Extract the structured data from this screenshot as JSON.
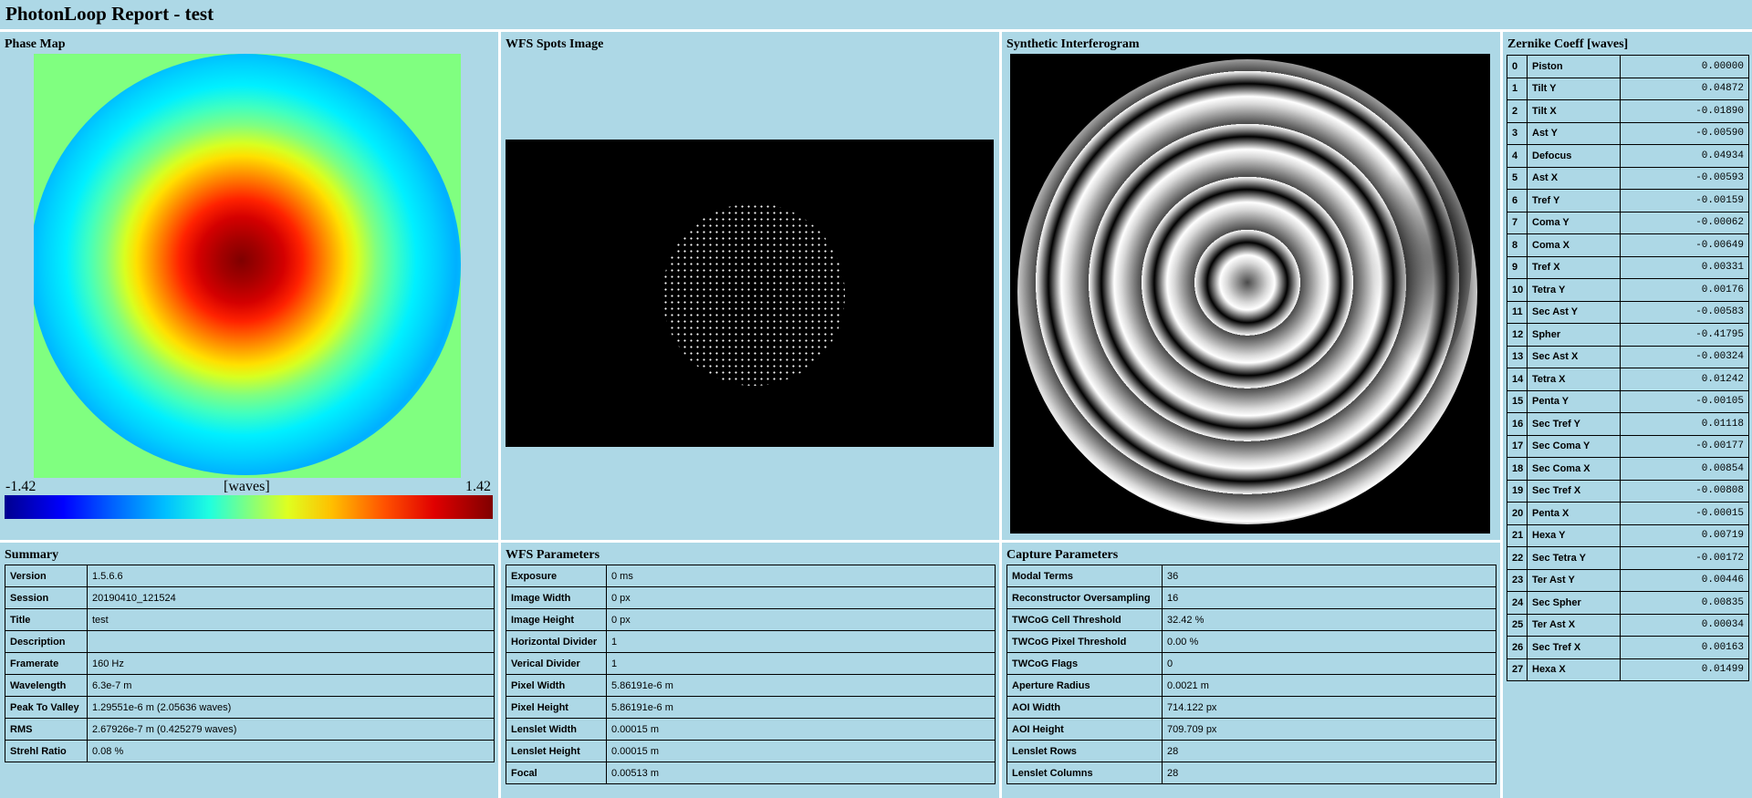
{
  "app": {
    "title": "PhotonLoop Report - test"
  },
  "phase_map": {
    "title": "Phase Map",
    "min_label": "-1.42",
    "max_label": "1.42",
    "unit_label": "[waves]"
  },
  "spots": {
    "title": "WFS Spots Image"
  },
  "interferogram": {
    "title": "Synthetic Interferogram"
  },
  "zernike": {
    "title": "Zernike Coeff [waves]",
    "rows": [
      {
        "index": "0",
        "name": "Piston",
        "value": "0.00000"
      },
      {
        "index": "1",
        "name": "Tilt Y",
        "value": "0.04872"
      },
      {
        "index": "2",
        "name": "Tilt X",
        "value": "-0.01890"
      },
      {
        "index": "3",
        "name": "Ast Y",
        "value": "-0.00590"
      },
      {
        "index": "4",
        "name": "Defocus",
        "value": "0.04934"
      },
      {
        "index": "5",
        "name": "Ast X",
        "value": "-0.00593"
      },
      {
        "index": "6",
        "name": "Tref Y",
        "value": "-0.00159"
      },
      {
        "index": "7",
        "name": "Coma Y",
        "value": "-0.00062"
      },
      {
        "index": "8",
        "name": "Coma X",
        "value": "-0.00649"
      },
      {
        "index": "9",
        "name": "Tref X",
        "value": "0.00331"
      },
      {
        "index": "10",
        "name": "Tetra Y",
        "value": "0.00176"
      },
      {
        "index": "11",
        "name": "Sec Ast Y",
        "value": "-0.00583"
      },
      {
        "index": "12",
        "name": "Spher",
        "value": "-0.41795"
      },
      {
        "index": "13",
        "name": "Sec Ast X",
        "value": "-0.00324"
      },
      {
        "index": "14",
        "name": "Tetra X",
        "value": "0.01242"
      },
      {
        "index": "15",
        "name": "Penta Y",
        "value": "-0.00105"
      },
      {
        "index": "16",
        "name": "Sec Tref Y",
        "value": "0.01118"
      },
      {
        "index": "17",
        "name": "Sec Coma Y",
        "value": "-0.00177"
      },
      {
        "index": "18",
        "name": "Sec Coma X",
        "value": "0.00854"
      },
      {
        "index": "19",
        "name": "Sec Tref X",
        "value": "-0.00808"
      },
      {
        "index": "20",
        "name": "Penta X",
        "value": "-0.00015"
      },
      {
        "index": "21",
        "name": "Hexa Y",
        "value": "0.00719"
      },
      {
        "index": "22",
        "name": "Sec Tetra Y",
        "value": "-0.00172"
      },
      {
        "index": "23",
        "name": "Ter Ast Y",
        "value": "0.00446"
      },
      {
        "index": "24",
        "name": "Sec Spher",
        "value": "0.00835"
      },
      {
        "index": "25",
        "name": "Ter Ast X",
        "value": "0.00034"
      },
      {
        "index": "26",
        "name": "Sec Tref X",
        "value": "0.00163"
      },
      {
        "index": "27",
        "name": "Hexa X",
        "value": "0.01499"
      }
    ]
  },
  "summary": {
    "title": "Summary",
    "rows": [
      {
        "key": "Version",
        "value": "1.5.6.6"
      },
      {
        "key": "Session",
        "value": "20190410_121524"
      },
      {
        "key": "Title",
        "value": "test"
      },
      {
        "key": "Description",
        "value": ""
      },
      {
        "key": "Framerate",
        "value": "160 Hz"
      },
      {
        "key": "Wavelength",
        "value": "6.3e-7 m"
      },
      {
        "key": "Peak To Valley",
        "value": "1.29551e-6 m (2.05636 waves)"
      },
      {
        "key": "RMS",
        "value": "2.67926e-7 m (0.425279 waves)"
      },
      {
        "key": "Strehl Ratio",
        "value": "0.08 %"
      }
    ]
  },
  "wfs_params": {
    "title": "WFS Parameters",
    "rows": [
      {
        "key": "Exposure",
        "value": "0 ms"
      },
      {
        "key": "Image Width",
        "value": "0 px"
      },
      {
        "key": "Image Height",
        "value": "0 px"
      },
      {
        "key": "Horizontal Divider",
        "value": "1"
      },
      {
        "key": "Verical Divider",
        "value": "1"
      },
      {
        "key": "Pixel Width",
        "value": "5.86191e-6 m"
      },
      {
        "key": "Pixel Height",
        "value": "5.86191e-6 m"
      },
      {
        "key": "Lenslet Width",
        "value": "0.00015 m"
      },
      {
        "key": "Lenslet Height",
        "value": "0.00015 m"
      },
      {
        "key": "Focal",
        "value": "0.00513 m"
      }
    ]
  },
  "capture_params": {
    "title": "Capture Parameters",
    "rows": [
      {
        "key": "Modal Terms",
        "value": "36"
      },
      {
        "key": "Reconstructor Oversampling",
        "value": "16"
      },
      {
        "key": "TWCoG Cell Threshold",
        "value": "32.42 %"
      },
      {
        "key": "TWCoG Pixel Threshold",
        "value": "0.00 %"
      },
      {
        "key": "TWCoG Flags",
        "value": "0"
      },
      {
        "key": "Aperture Radius",
        "value": "0.0021 m"
      },
      {
        "key": "AOI Width",
        "value": "714.122 px"
      },
      {
        "key": "AOI Height",
        "value": "709.709 px"
      },
      {
        "key": "Lenslet Rows",
        "value": "28"
      },
      {
        "key": "Lenslet Columns",
        "value": "28"
      }
    ]
  }
}
